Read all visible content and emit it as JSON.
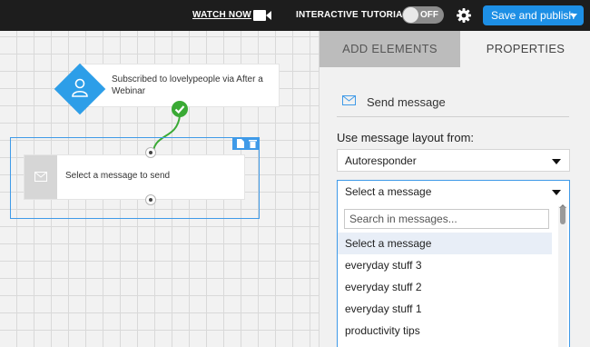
{
  "topbar": {
    "watch_label": "WATCH NOW",
    "tutorial_label": "INTERACTIVE TUTORIAL",
    "toggle_state": "OFF",
    "save_label": "Save and publish",
    "icons": [
      "video-camera-icon",
      "gear-icon",
      "dropdown-caret-icon"
    ],
    "colors": {
      "bar": "#1d1d1d",
      "save_button": "#1d8fe5"
    }
  },
  "canvas": {
    "trigger": {
      "text": "Subscribed to lovelypeople via After a Webinar",
      "icon": "person-icon",
      "color": "#2d9ee8"
    },
    "action": {
      "text": "Select a message to send",
      "icon": "envelope-icon"
    },
    "selection_icons": [
      "document-icon",
      "trash-icon"
    ],
    "connector_status_icon": "checkmark-icon",
    "connector_color": "#3aaa35"
  },
  "panel": {
    "tabs": [
      {
        "label": "ADD ELEMENTS",
        "active": false
      },
      {
        "label": "PROPERTIES",
        "active": true
      }
    ],
    "header": {
      "title": "Send message",
      "icon": "envelope-icon"
    },
    "layout_label": "Use message layout from:",
    "layout_value": "Autoresponder",
    "message_select": {
      "value": "Select a message",
      "search_placeholder": "Search in messages...",
      "options": [
        "Select a message",
        "everyday stuff 3",
        "everyday stuff 2",
        "everyday stuff 1",
        "productivity tips"
      ],
      "highlighted_index": 0
    },
    "accent_color": "#3f9ae8"
  }
}
